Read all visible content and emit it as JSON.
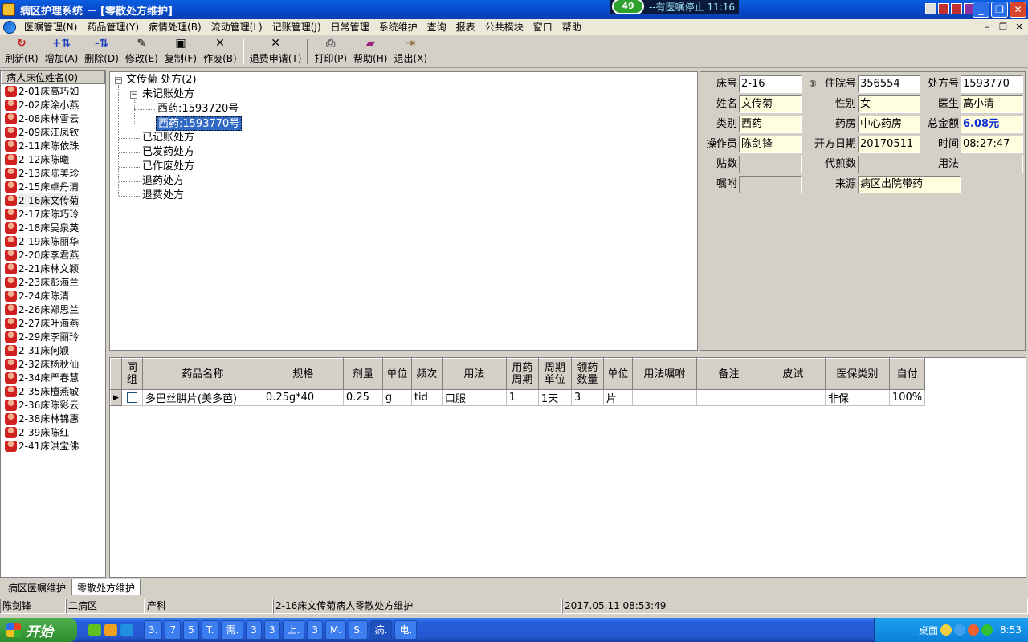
{
  "window": {
    "title": "病区护理系统 － [零散处方维护]",
    "notice_badge": "49",
    "notice_text": "--有医嘱停止 11:16"
  },
  "menu": [
    "医嘱管理(N)",
    "药品管理(Y)",
    "病情处理(B)",
    "流动管理(L)",
    "记账管理(J)",
    "日常管理",
    "系统维护",
    "查询",
    "报表",
    "公共模块",
    "窗口",
    "帮助"
  ],
  "toolbar": {
    "refresh": "刷新(R)",
    "add": "增加(A)",
    "delete": "删除(D)",
    "modify": "修改(E)",
    "copy": "复制(F)",
    "void": "作废(B)",
    "refund": "退费申请(T)",
    "print": "打印(P)",
    "help": "帮助(H)",
    "exit": "退出(X)"
  },
  "patients": {
    "header": "病人床位姓名(0)",
    "items": [
      "2-01床高巧如",
      "2-02床涂小燕",
      "2-08床林雪云",
      "2-09床江凤钦",
      "2-11床陈依珠",
      "2-12床陈曦",
      "2-13床陈美珍",
      "2-15床卓丹清",
      "2-16床文传菊",
      "2-17床陈巧玲",
      "2-18床吴泉英",
      "2-19床陈丽华",
      "2-20床李君燕",
      "2-21床林文颖",
      "2-23床彭海兰",
      "2-24床陈清",
      "2-26床郑思兰",
      "2-27床叶海燕",
      "2-29床李丽玲",
      "2-31床何颖",
      "2-32床杨秋仙",
      "2-34床严春慧",
      "2-35床檀燕敏",
      "2-36床陈彩云",
      "2-38床林锦惠",
      "2-39床陈红",
      "2-41床洪宝佛"
    ],
    "selected": "2-16床文传菊"
  },
  "tree": {
    "root": "文传菊 处方(2)",
    "unbilled": "未记账处方",
    "rx1": "西药:1593720号",
    "rx2": "西药:1593770号",
    "billed": "已记账处方",
    "dispensed": "已发药处方",
    "voided": "已作废处方",
    "returned": "退药处方",
    "refunded": "退费处方"
  },
  "info": {
    "bed_lbl": "床号",
    "bed": "2-16",
    "circle1": "①",
    "admission_lbl": "住院号",
    "admission": "356554",
    "rxno_lbl": "处方号",
    "rxno": "1593770",
    "name_lbl": "姓名",
    "name": "文传菊",
    "sex_lbl": "性别",
    "sex": "女",
    "doctor_lbl": "医生",
    "doctor": "高小清",
    "category_lbl": "类别",
    "category": "西药",
    "pharmacy_lbl": "药房",
    "pharmacy": "中心药房",
    "total_lbl": "总金额",
    "total": "6.08元",
    "operator_lbl": "操作员",
    "operator": "陈剑锋",
    "date_lbl": "开方日期",
    "date": "20170511",
    "time_lbl": "时间",
    "time": "08:27:47",
    "doses_lbl": "贴数",
    "doses": "",
    "decoct_lbl": "代煎数",
    "decoct": "",
    "usage_lbl": "用法",
    "usage": "",
    "instruct_lbl": "嘱咐",
    "instruct": "",
    "source_lbl": "来源",
    "source": "病区出院带药"
  },
  "grid": {
    "headers": [
      "同组",
      "药品名称",
      "规格",
      "剂量",
      "单位",
      "频次",
      "用法",
      "用药周期",
      "周期单位",
      "领药数量",
      "单位",
      "用法嘱咐",
      "备注",
      "皮试",
      "医保类别",
      "自付"
    ],
    "rows": [
      [
        "多巴丝肼片(美多芭)",
        "0.25g*40",
        "0.25",
        "g",
        "tid",
        "口服",
        "1",
        "1天",
        "3",
        "片",
        "",
        "",
        "",
        "非保",
        "100%"
      ]
    ]
  },
  "tabs": [
    "病区医嘱维护",
    "零散处方维护"
  ],
  "status": {
    "user": "陈剑锋",
    "ward": "二病区",
    "dept": "产科",
    "desc": "2-16床文传菊病人零散处方维护",
    "datetime": "2017.05.11 08:53:49"
  },
  "taskbar": {
    "start": "开始",
    "buttons": [
      "3.",
      "7",
      "5",
      "T.",
      "需.",
      "3",
      "3",
      "上.",
      "3",
      "M.",
      "S.",
      "病.",
      "电."
    ],
    "desktop": "桌面",
    "clock": "8:53"
  }
}
